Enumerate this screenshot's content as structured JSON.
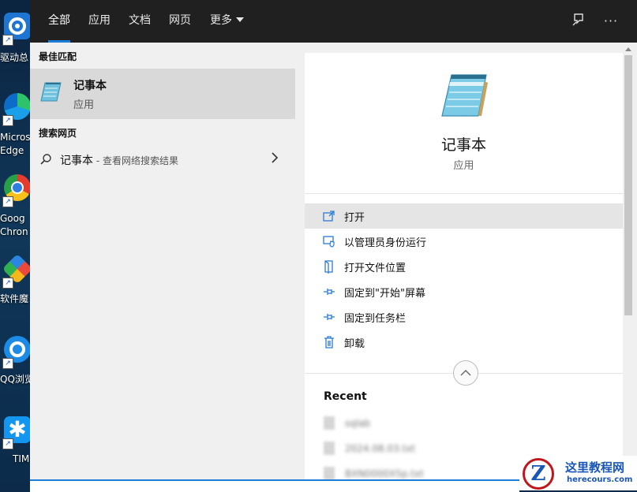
{
  "desktop": {
    "icons": [
      {
        "label": "驱动总"
      },
      {
        "label": "Micros\nEdge"
      },
      {
        "label": "Goog\nChron"
      },
      {
        "label": "软件魔"
      },
      {
        "label": "QQ浏览"
      },
      {
        "label": "TIM"
      }
    ]
  },
  "tabs": {
    "all": "全部",
    "apps": "应用",
    "docs": "文档",
    "web": "网页",
    "more": "更多"
  },
  "top_icons": [
    "feedback-icon",
    "more-options-icon"
  ],
  "best_match": {
    "section_title": "最佳匹配",
    "name": "记事本",
    "type": "应用"
  },
  "web_search": {
    "section_title": "搜索网页",
    "query": "记事本",
    "hint": " - 查看网络搜索结果"
  },
  "details": {
    "name": "记事本",
    "type": "应用",
    "actions": [
      {
        "label": "打开",
        "icon": "open-icon"
      },
      {
        "label": "以管理员身份运行",
        "icon": "run-as-admin-icon"
      },
      {
        "label": "打开文件位置",
        "icon": "file-location-icon"
      },
      {
        "label": "固定到\"开始\"屏幕",
        "icon": "pin-icon"
      },
      {
        "label": "固定到任务栏",
        "icon": "pin-icon"
      },
      {
        "label": "卸载",
        "icon": "trash-icon"
      }
    ],
    "recent_title": "Recent",
    "recent_items": [
      "sqlab",
      "2024.08.03.txt",
      "BXN0000X5p.txt"
    ]
  },
  "watermark": {
    "title": "这里教程网",
    "url": "herecours.com"
  },
  "colors": {
    "accent": "#1b7fd9",
    "tabbar": "#202020",
    "panel": "#f0f0f0",
    "selected": "#d9d9d9"
  }
}
